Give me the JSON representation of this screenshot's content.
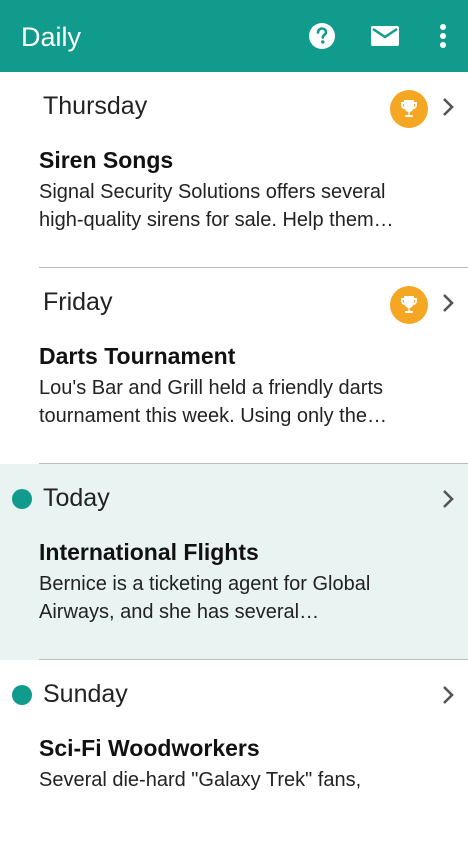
{
  "appbar": {
    "title": "Daily",
    "icons": [
      "help-icon",
      "mail-icon",
      "more-vert-icon"
    ]
  },
  "colors": {
    "primary": "#119b8c",
    "trophy": "#f5a623",
    "today_bg": "#e8f3f2"
  },
  "items": [
    {
      "day": "Thursday",
      "title": "Siren Songs",
      "snippet_line1": "Signal Security Solutions offers several",
      "snippet_line2": "high-quality sirens for sale.  Help them…",
      "status": "trophy"
    },
    {
      "day": "Friday",
      "title": "Darts Tournament",
      "snippet_line1": "Lou's Bar and Grill held a friendly darts",
      "snippet_line2": "tournament this week.  Using only the…",
      "status": "trophy"
    },
    {
      "day": "Today",
      "title": "International Flights",
      "snippet_line1": "Bernice is a ticketing agent for Global",
      "snippet_line2": "Airways, and she has several…",
      "status": "new-dot"
    },
    {
      "day": "Sunday",
      "title": "Sci-Fi Woodworkers",
      "snippet_line1": "Several die-hard \"Galaxy Trek\" fans,",
      "snippet_line2": "",
      "status": "new-dot"
    }
  ]
}
